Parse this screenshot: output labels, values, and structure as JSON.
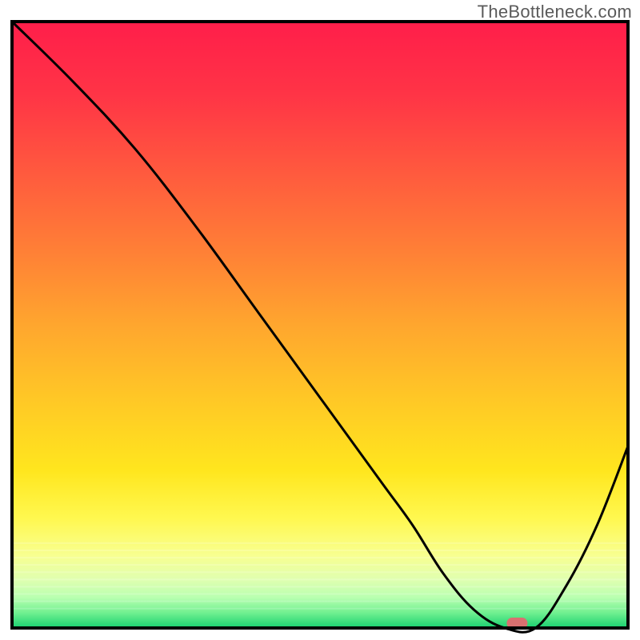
{
  "watermark": "TheBottleneck.com",
  "chart_data": {
    "type": "line",
    "title": "",
    "xlabel": "",
    "ylabel": "",
    "xlim": [
      0,
      100
    ],
    "ylim": [
      0,
      100
    ],
    "x": [
      0,
      10,
      20,
      30,
      40,
      50,
      60,
      65,
      70,
      75,
      80,
      85,
      90,
      95,
      100
    ],
    "values": [
      100,
      90,
      79,
      66,
      52,
      38,
      24,
      17,
      9,
      3,
      0,
      0,
      7,
      17,
      30
    ],
    "annotations": [
      {
        "type": "marker",
        "x": 82,
        "y": 0,
        "color": "#d97070",
        "shape": "rounded-rect"
      }
    ],
    "background": {
      "type": "vertical-gradient",
      "stops": [
        {
          "offset": 0.0,
          "color": "#ff1e4a"
        },
        {
          "offset": 0.12,
          "color": "#ff3446"
        },
        {
          "offset": 0.25,
          "color": "#ff5a3e"
        },
        {
          "offset": 0.38,
          "color": "#ff8036"
        },
        {
          "offset": 0.5,
          "color": "#ffa62e"
        },
        {
          "offset": 0.62,
          "color": "#ffc726"
        },
        {
          "offset": 0.74,
          "color": "#ffe61e"
        },
        {
          "offset": 0.82,
          "color": "#fff850"
        },
        {
          "offset": 0.88,
          "color": "#f8ff90"
        },
        {
          "offset": 0.92,
          "color": "#e0ffb0"
        },
        {
          "offset": 0.95,
          "color": "#b8ffb0"
        },
        {
          "offset": 0.975,
          "color": "#70f090"
        },
        {
          "offset": 1.0,
          "color": "#18d070"
        }
      ]
    },
    "frame": {
      "stroke": "#000000",
      "width": 4
    }
  }
}
